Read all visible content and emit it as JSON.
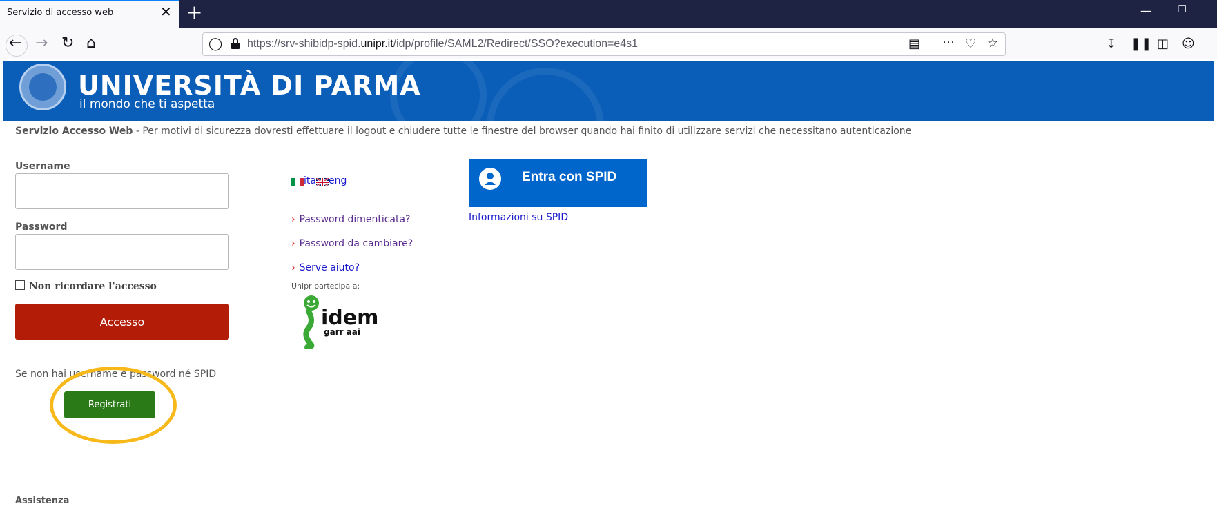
{
  "browser": {
    "tab_title": "Servizio di accesso web",
    "tab_close": "✕",
    "new_tab": "+",
    "url_prefix": "https://srv-shibidp-spid.",
    "url_host": "unipr.it",
    "url_path": "/idp/profile/SAML2/Redirect/SSO?execution=e4s1"
  },
  "header": {
    "university_name": "UNIVERSITÀ DI PARMA",
    "tagline": "il mondo che ti aspetta",
    "colors": {
      "banner": "#0a5eb8"
    }
  },
  "notice": {
    "title": "Servizio Accesso Web",
    "text": " - Per motivi di sicurezza dovresti effettuare il logout e chiudere tutte le finestre del browser quando hai finito di utilizzare servizi che necessitano autenticazione"
  },
  "login": {
    "username_label": "Username",
    "password_label": "Password",
    "remember_label": "Non ricordare l'accesso",
    "submit_label": "Accesso",
    "no_account_text": "Se non hai username e password né SPID",
    "register_label": "Registrati",
    "colors": {
      "submit": "#b31d08",
      "register": "#2a7a18",
      "highlight": "#f7b91a"
    }
  },
  "languages": {
    "ita": "ita",
    "eng": "eng"
  },
  "links": {
    "forgot": "Password dimenticata?",
    "change": "Password da cambiare?",
    "help": "Serve aiuto?"
  },
  "participation": {
    "label": "Unipr partecipa a:",
    "logo_text": "idem",
    "logo_sub": "garr aai"
  },
  "spid": {
    "button_label": "Entra con SPID",
    "info_link": "Informazioni su SPID",
    "color": "#0066cc"
  },
  "footer": {
    "assistenza": "Assistenza"
  }
}
